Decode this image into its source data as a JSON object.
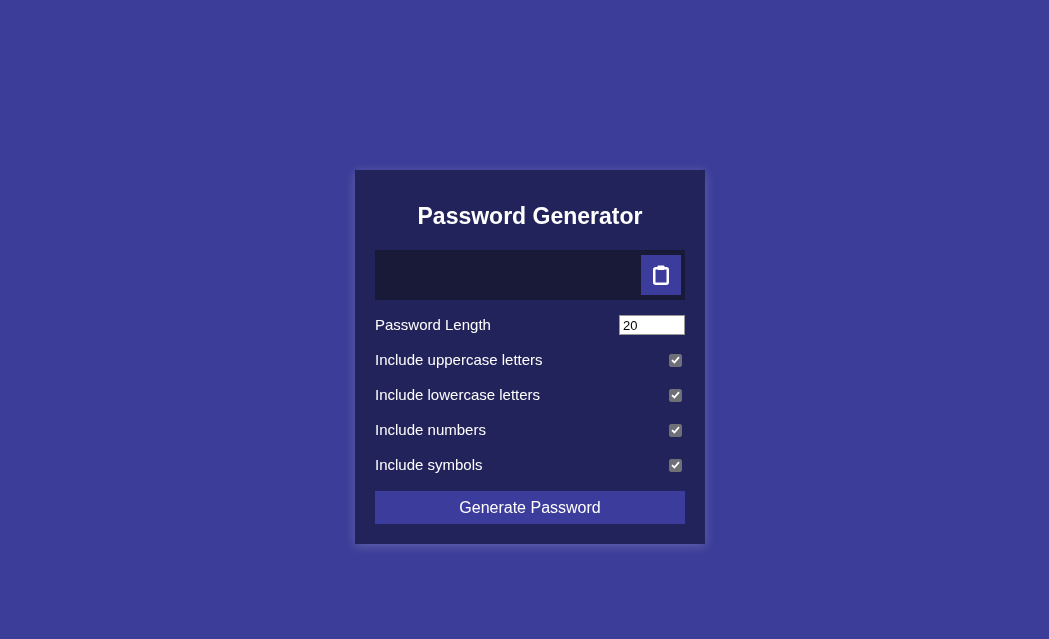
{
  "card": {
    "title": "Password Generator"
  },
  "result": {
    "copy_button": {
      "kind": "clipboard"
    }
  },
  "length": {
    "label": "Password Length",
    "value": "20"
  },
  "options": [
    {
      "label": "Include uppercase letters",
      "checked": true
    },
    {
      "label": "Include lowercase letters",
      "checked": true
    },
    {
      "label": "Include numbers",
      "checked": true
    },
    {
      "label": "Include symbols",
      "checked": true
    }
  ],
  "generate_button": {
    "label": "Generate Password"
  }
}
